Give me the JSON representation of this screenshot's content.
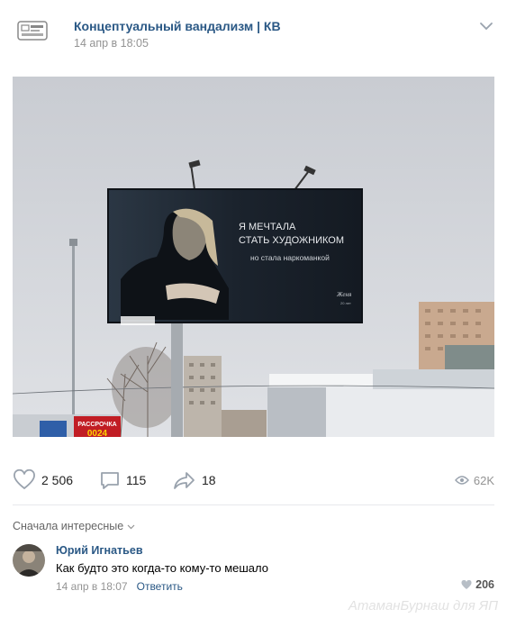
{
  "post": {
    "group_name": "Концептуальный вандализм | КВ",
    "date": "14 апр в 18:05",
    "icons": {
      "avatar": "group-logo",
      "menu": "chevron-down-icon"
    }
  },
  "billboard": {
    "line1": "Я МЕЧТАЛА",
    "line2": "СТАТЬ ХУДОЖНИКОМ",
    "line3": "но стала наркоманкой",
    "signature": "Женя",
    "age": "20 лет",
    "store_sign": "РАССРОЧКА",
    "store_digits": "0024"
  },
  "actions": {
    "likes": "2 506",
    "comments": "115",
    "shares": "18",
    "views": "62K"
  },
  "comments_section": {
    "sort_label": "Сначала интересные",
    "comment": {
      "author": "Юрий Игнатьев",
      "text": "Как будто это когда-то кому-то мешало",
      "date": "14 апр в 18:07",
      "reply": "Ответить",
      "likes": "206"
    }
  },
  "watermark": "АтаманБурнаш для ЯП",
  "colors": {
    "link": "#2a5885",
    "meta": "#939393",
    "sky": "#d4d7dc",
    "billboard": "#1e2630"
  }
}
